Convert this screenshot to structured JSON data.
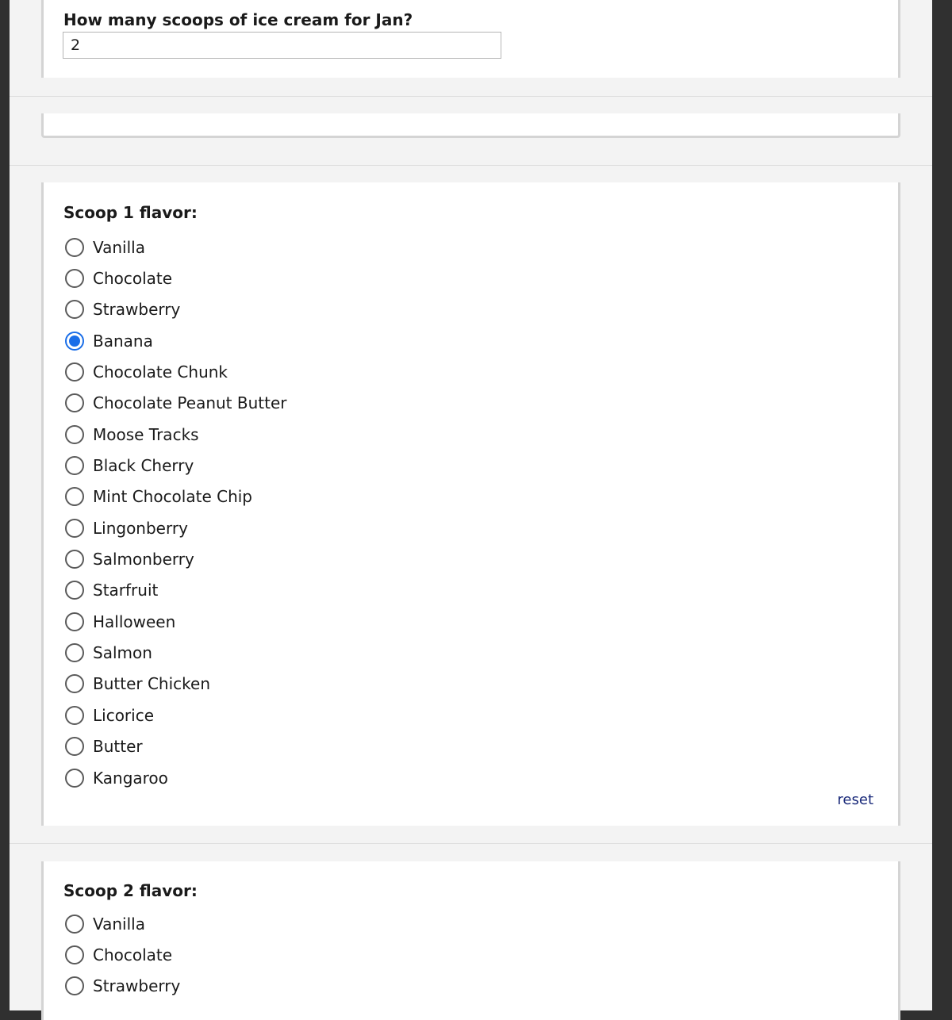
{
  "scoops_question": {
    "label": "How many scoops of ice cream for Jan?",
    "value": "2"
  },
  "scoop1": {
    "label": "Scoop 1 flavor:",
    "options": [
      {
        "label": "Vanilla",
        "checked": false
      },
      {
        "label": "Chocolate",
        "checked": false
      },
      {
        "label": "Strawberry",
        "checked": false
      },
      {
        "label": "Banana",
        "checked": true
      },
      {
        "label": "Chocolate Chunk",
        "checked": false
      },
      {
        "label": "Chocolate Peanut Butter",
        "checked": false
      },
      {
        "label": "Moose Tracks",
        "checked": false
      },
      {
        "label": "Black Cherry",
        "checked": false
      },
      {
        "label": "Mint Chocolate Chip",
        "checked": false
      },
      {
        "label": "Lingonberry",
        "checked": false
      },
      {
        "label": "Salmonberry",
        "checked": false
      },
      {
        "label": "Starfruit",
        "checked": false
      },
      {
        "label": "Halloween",
        "checked": false
      },
      {
        "label": "Salmon",
        "checked": false
      },
      {
        "label": "Butter Chicken",
        "checked": false
      },
      {
        "label": "Licorice",
        "checked": false
      },
      {
        "label": "Butter",
        "checked": false
      },
      {
        "label": "Kangaroo",
        "checked": false
      }
    ],
    "reset_label": "reset"
  },
  "scoop2": {
    "label": "Scoop 2 flavor:",
    "options": [
      {
        "label": "Vanilla",
        "checked": false
      },
      {
        "label": "Chocolate",
        "checked": false
      },
      {
        "label": "Strawberry",
        "checked": false
      }
    ]
  },
  "colors": {
    "accent": "#1a6ee8",
    "link": "#1a2a7a"
  }
}
